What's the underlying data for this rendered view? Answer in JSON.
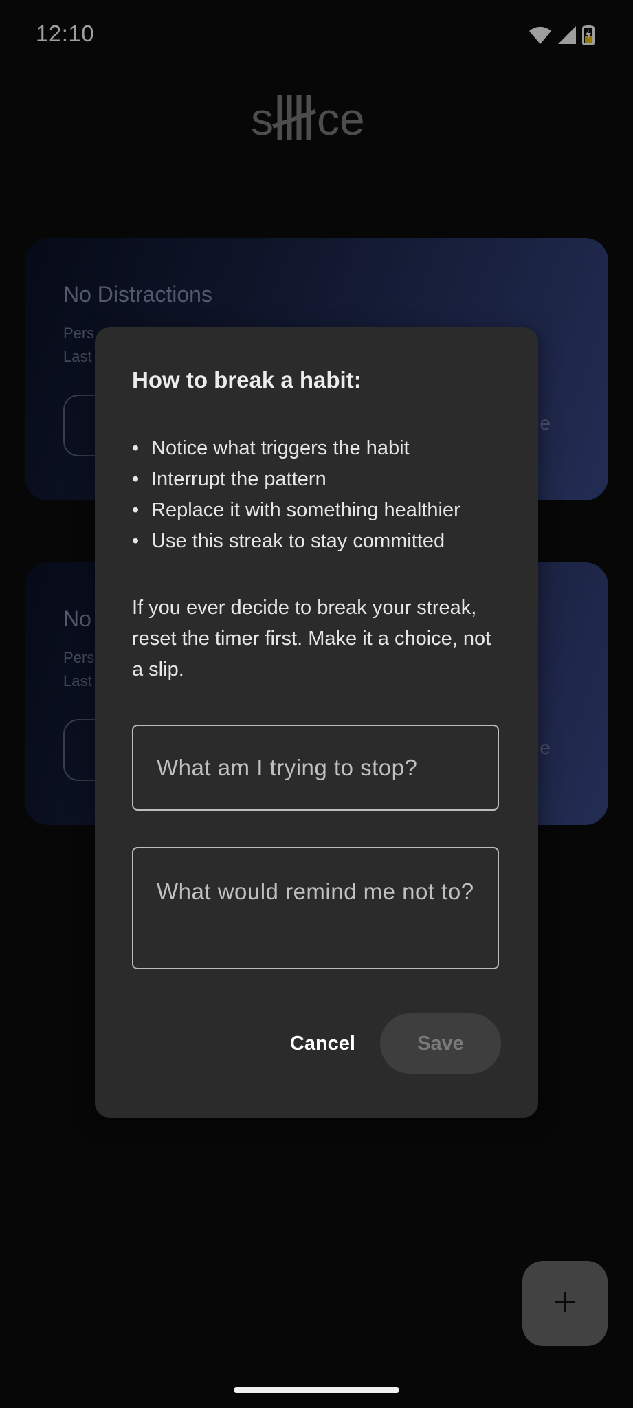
{
  "status_bar": {
    "time": "12:10",
    "icons": [
      "wifi-icon",
      "signal-icon",
      "battery-charging-icon"
    ]
  },
  "app": {
    "logo_text": "silence"
  },
  "cards": [
    {
      "title": "No Distractions",
      "sub_line_1": "Pers",
      "sub_line_2": "Last",
      "right_label": "e"
    },
    {
      "title": "No",
      "sub_line_1": "Pers",
      "sub_line_2": "Last",
      "right_label": "e"
    }
  ],
  "dialog": {
    "title": "How to break a habit:",
    "bullets": [
      "Notice what triggers the habit",
      "Interrupt the pattern",
      "Replace it with something healthier",
      "Use this streak to stay committed"
    ],
    "paragraph": "If you ever decide to break your streak, reset the timer first. Make it a choice, not a slip.",
    "field_1_placeholder": "What am I trying to stop?",
    "field_2_placeholder": "What would remind me not to?",
    "cancel_label": "Cancel",
    "save_label": "Save"
  },
  "fab": {
    "icon": "plus-icon"
  },
  "colors": {
    "background": "#0c0c0c",
    "dialog": "#2b2b2b",
    "card_gradient_end": "#394887",
    "fab": "#6b6b6b"
  }
}
